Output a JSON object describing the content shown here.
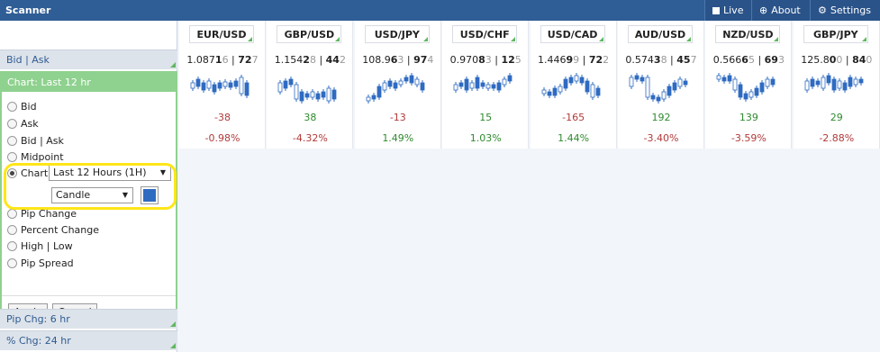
{
  "window": {
    "title": "Scanner"
  },
  "toolbar": {
    "live": "Live",
    "about": "About",
    "settings": "Settings"
  },
  "sidebar": {
    "bid_ask": "Bid | Ask",
    "panel_title": "Chart: Last 12 hr",
    "options": [
      "Bid",
      "Ask",
      "Bid | Ask",
      "Midpoint",
      "Chart",
      "Pip Change",
      "Percent Change",
      "High | Low",
      "Pip Spread"
    ],
    "selected": "Chart",
    "period_select": "Last 12 Hours (1H)",
    "type_select": "Candle",
    "apply": "Apply",
    "cancel": "Cancel",
    "pip_chg": "Pip Chg: 6 hr",
    "pct_chg": "% Chg: 24 hr"
  },
  "colors": {
    "accent": "#2f5d95",
    "panel": "#8fd18f",
    "highlight": "#ffe617",
    "candle": "#2f6bc1",
    "negative": "#b23a3a",
    "positive": "#2f8a2f"
  },
  "pairs": [
    {
      "symbol": "EUR/USD",
      "bid_pre": "1.087",
      "bid_big": "1",
      "bid_pip": "6",
      "ask_big": "72",
      "ask_pip": "7",
      "pips": "-38",
      "pct": "-0.98%",
      "pips_dir": "neg",
      "pct_dir": "neg"
    },
    {
      "symbol": "GBP/USD",
      "bid_pre": "1.154",
      "bid_big": "2",
      "bid_pip": "8",
      "ask_big": "44",
      "ask_pip": "2",
      "pips": "38",
      "pct": "-4.32%",
      "pips_dir": "pos",
      "pct_dir": "neg"
    },
    {
      "symbol": "USD/JPY",
      "bid_pre": "108.9",
      "bid_big": "6",
      "bid_pip": "3",
      "ask_big": "97",
      "ask_pip": "4",
      "pips": "-13",
      "pct": "1.49%",
      "pips_dir": "neg",
      "pct_dir": "pos"
    },
    {
      "symbol": "USD/CHF",
      "bid_pre": "0.970",
      "bid_big": "8",
      "bid_pip": "3",
      "ask_big": "12",
      "ask_pip": "5",
      "pips": "15",
      "pct": "1.03%",
      "pips_dir": "pos",
      "pct_dir": "pos"
    },
    {
      "symbol": "USD/CAD",
      "bid_pre": "1.446",
      "bid_big": "9",
      "bid_pip": "9",
      "ask_big": "72",
      "ask_pip": "2",
      "pips": "-165",
      "pct": "1.44%",
      "pips_dir": "neg",
      "pct_dir": "pos"
    },
    {
      "symbol": "AUD/USD",
      "bid_pre": "0.574",
      "bid_big": "3",
      "bid_pip": "8",
      "ask_big": "45",
      "ask_pip": "7",
      "pips": "192",
      "pct": "-3.40%",
      "pips_dir": "pos",
      "pct_dir": "neg"
    },
    {
      "symbol": "NZD/USD",
      "bid_pre": "0.566",
      "bid_big": "6",
      "bid_pip": "5",
      "ask_big": "69",
      "ask_pip": "3",
      "pips": "139",
      "pct": "-3.59%",
      "pips_dir": "pos",
      "pct_dir": "neg"
    },
    {
      "symbol": "GBP/JPY",
      "bid_pre": "125.8",
      "bid_big": "0",
      "bid_pip": "0",
      "ask_big": "84",
      "ask_pip": "0",
      "pips": "29",
      "pct": "-2.88%",
      "pips_dir": "pos",
      "pct_dir": "neg"
    }
  ]
}
